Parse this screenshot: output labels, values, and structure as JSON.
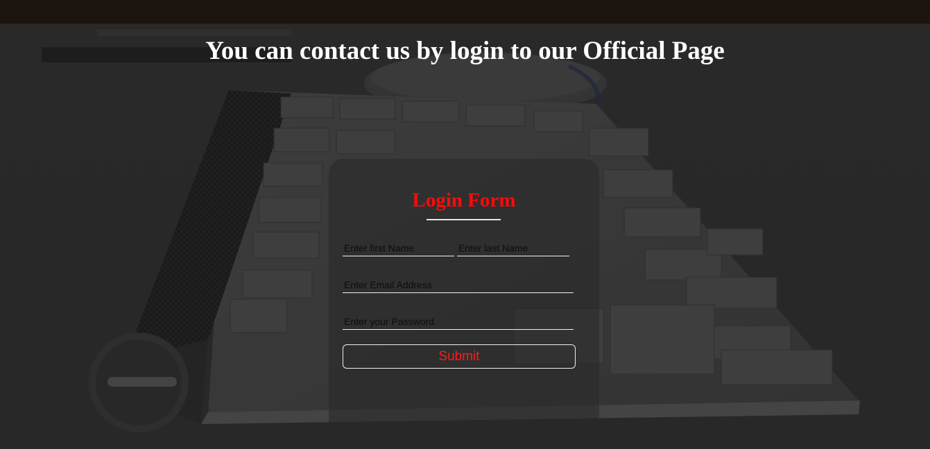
{
  "header": {
    "title": "You can contact us by login to our Official Page"
  },
  "login_form": {
    "title": "Login Form",
    "first_name_placeholder": "Enter first Name",
    "last_name_placeholder": "Enter last Name",
    "email_placeholder": "Enter Email Address",
    "password_placeholder": "Enter your Password",
    "submit_label": "Submit"
  },
  "colors": {
    "accent": "#ff0a0a",
    "heading": "#ffffff",
    "background": "#2a2a2a"
  }
}
